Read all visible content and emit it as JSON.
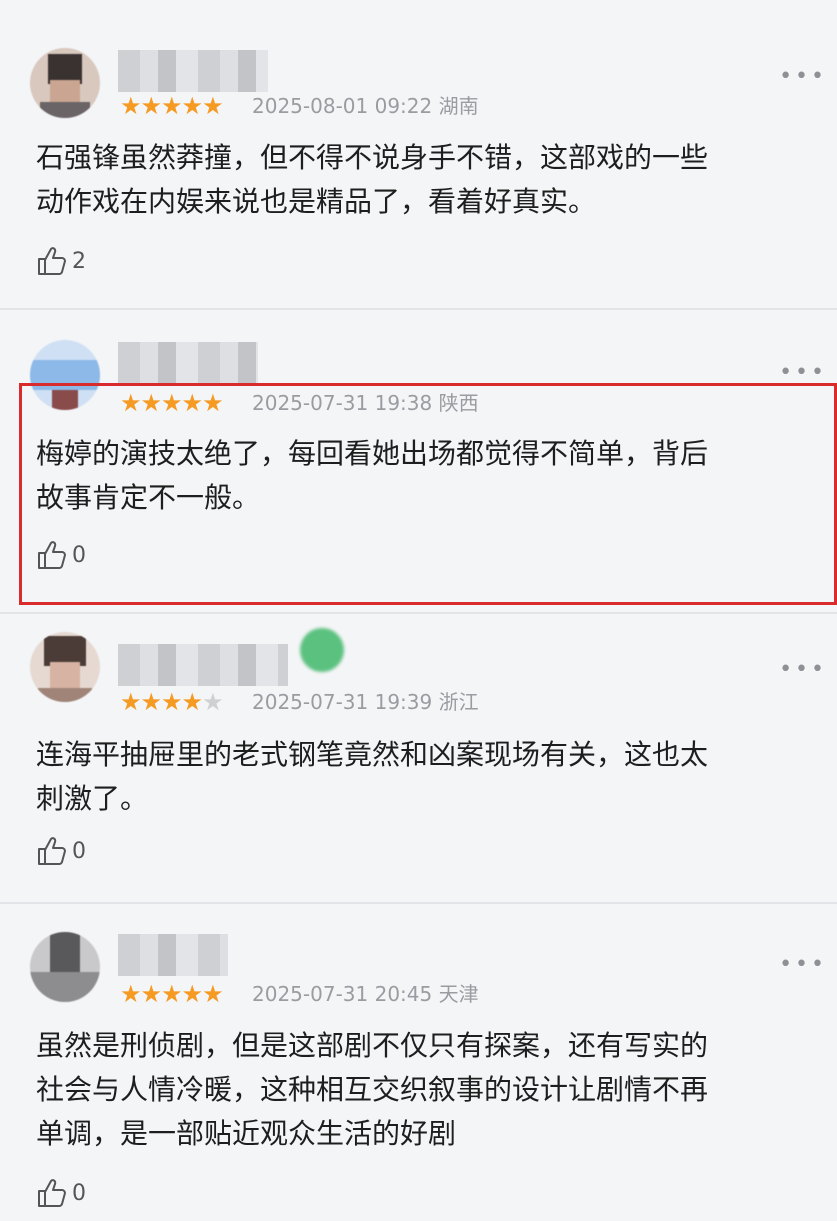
{
  "comments": [
    {
      "stars": 5,
      "date": "2025-08-01 09:22",
      "region": "湖南",
      "lines": [
        "石强锋虽然莽撞，但不得不说身手不错，这部戏的一些",
        "动作戏在内娱来说也是精品了，看着好真实。"
      ],
      "likes": "2"
    },
    {
      "stars": 5,
      "date": "2025-07-31 19:38",
      "region": "陕西",
      "lines": [
        "梅婷的演技太绝了，每回看她出场都觉得不简单，背后",
        "故事肯定不一般。"
      ],
      "likes": "0"
    },
    {
      "stars": 4,
      "date": "2025-07-31 19:39",
      "region": "浙江",
      "lines": [
        "连海平抽屉里的老式钢笔竟然和凶案现场有关，这也太",
        "刺激了。"
      ],
      "likes": "0"
    },
    {
      "stars": 5,
      "date": "2025-07-31 20:45",
      "region": "天津",
      "lines": [
        "虽然是刑侦剧，但是这部剧不仅只有探案，还有写实的",
        "社会与人情冷暖，这种相互交织叙事的设计让剧情不再",
        "单调，是一部贴近观众生活的好剧"
      ],
      "likes": "0"
    }
  ],
  "icons": {
    "like": "thumbs-up-icon",
    "more": "more-dots-icon",
    "star": "star-icon"
  },
  "colors": {
    "star": "#f59a22",
    "highlight": "#d92b2b",
    "meta": "#9a9ca1"
  }
}
